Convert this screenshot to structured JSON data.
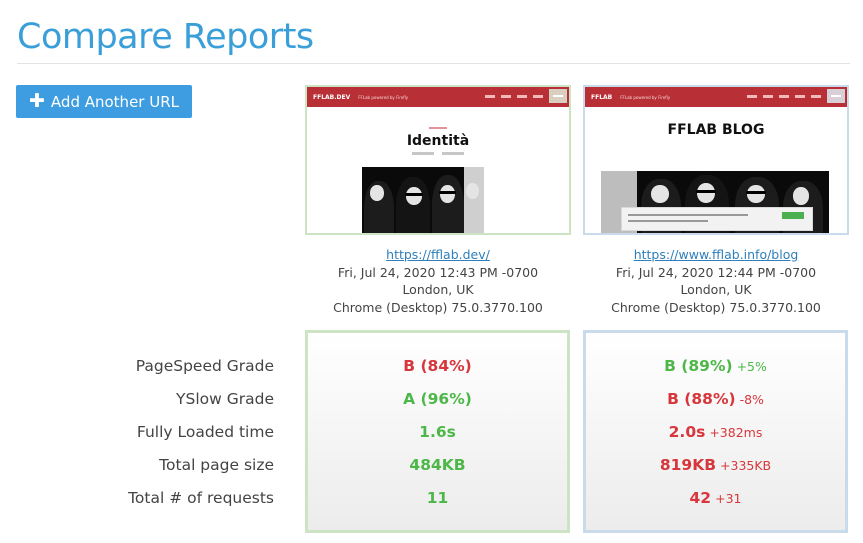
{
  "page": {
    "title": "Compare Reports",
    "add_button_label": "Add Another URL"
  },
  "reports": [
    {
      "thumbnail": {
        "brand": "FFLAB.DEV",
        "tagline": "FFLab powered by Firefly",
        "headline": "Identità"
      },
      "url": "https://fflab.dev/",
      "date": "Fri, Jul 24, 2020 12:43 PM -0700",
      "location": "London, UK",
      "browser": "Chrome (Desktop) 75.0.3770.100",
      "border_color": "#cde4c4"
    },
    {
      "thumbnail": {
        "brand": "FFLAB",
        "tagline": "FFLab powered by Firefly",
        "headline": "FFLAB BLOG"
      },
      "url": "https://www.fflab.info/blog",
      "date": "Fri, Jul 24, 2020 12:44 PM -0700",
      "location": "London, UK",
      "browser": "Chrome (Desktop) 75.0.3770.100",
      "border_color": "#c9daea"
    }
  ],
  "metric_labels": [
    "PageSpeed Grade",
    "YSlow Grade",
    "Fully Loaded time",
    "Total page size",
    "Total # of requests"
  ],
  "results": {
    "left": [
      {
        "value": "B (84%)",
        "status": "bad"
      },
      {
        "value": "A (96%)",
        "status": "good"
      },
      {
        "value": "1.6s",
        "status": "good"
      },
      {
        "value": "484KB",
        "status": "good"
      },
      {
        "value": "11",
        "status": "good"
      }
    ],
    "right": [
      {
        "value": "B (89%)",
        "delta": "+5%",
        "status": "good"
      },
      {
        "value": "B (88%)",
        "delta": "-8%",
        "status": "bad"
      },
      {
        "value": "2.0s",
        "delta": "+382ms",
        "status": "bad"
      },
      {
        "value": "819KB",
        "delta": "+335KB",
        "status": "bad"
      },
      {
        "value": "42",
        "delta": "+31",
        "status": "bad"
      }
    ]
  },
  "colors": {
    "good": "#4db848",
    "bad": "#d7373c",
    "accent": "#3a9fd8",
    "button": "#3d9de0"
  }
}
